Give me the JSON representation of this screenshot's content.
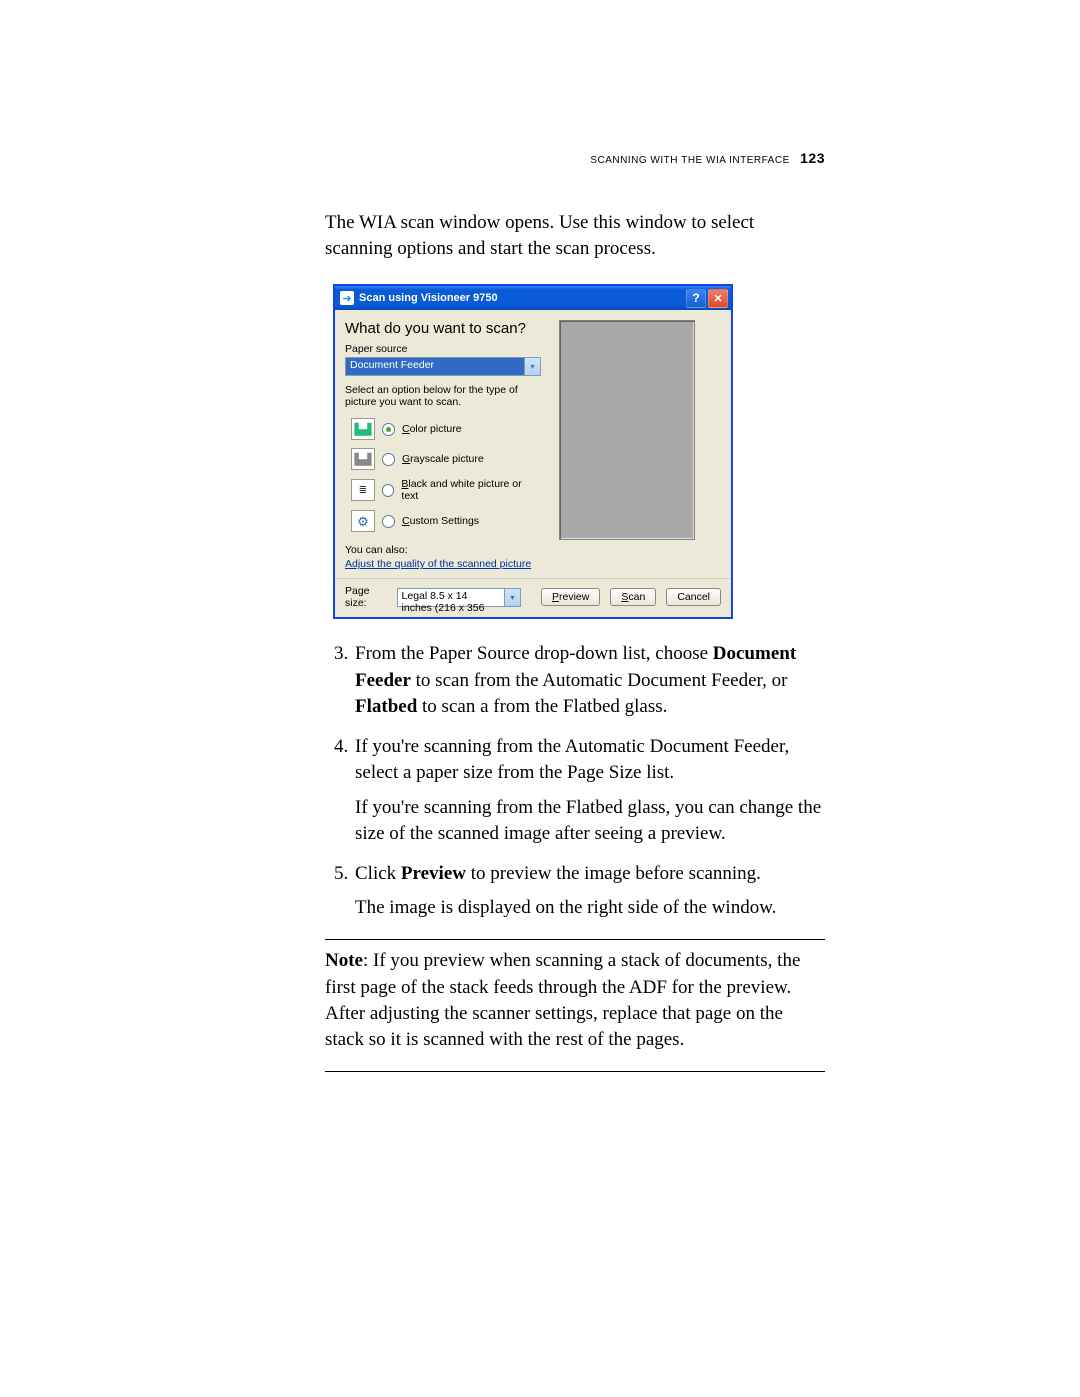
{
  "header": {
    "section": "Scanning with the WIA Interface",
    "page": "123"
  },
  "intro": "The WIA scan window opens. Use this window to select scanning options and start the scan process.",
  "window": {
    "title": "Scan using Visioneer 9750",
    "help": "?",
    "close": "✕",
    "heading": "What do you want to scan?",
    "paper_source_label": "Paper source",
    "paper_source_value": "Document Feeder",
    "select_instruction": "Select an option below for the type of picture you want to scan.",
    "options": {
      "color_pre": "C",
      "color_rest": "olor picture",
      "gray_pre": "G",
      "gray_rest": "rayscale picture",
      "bw_pre": "B",
      "bw_rest": "lack and white picture or text",
      "custom_pre": "C",
      "custom_rest": "ustom Settings"
    },
    "also_label": "You can also:",
    "adjust_link": "Adjust the quality of the scanned picture",
    "page_size_label": "Page size:",
    "page_size_value": "Legal 8.5 x 14 inches (216 x 356",
    "btn_preview_pre": "P",
    "btn_preview_rest": "review",
    "btn_scan_pre": "S",
    "btn_scan_rest": "can",
    "btn_cancel": "Cancel"
  },
  "steps": {
    "s3a": "From the Paper Source drop-down list, choose ",
    "s3b": "Document Feeder",
    "s3c": " to scan from the Automatic Document Feeder, or ",
    "s3d": "Flatbed",
    "s3e": " to scan a from the Flatbed glass.",
    "s4a": "If you're scanning from the Automatic Document Feeder, select a paper size from the Page Size list.",
    "s4b": "If you're scanning from the Flatbed glass, you can change the size of the scanned image after seeing a preview.",
    "s5a": "Click ",
    "s5b": "Preview",
    "s5c": " to preview the image before scanning.",
    "s5d": "The image is displayed on the right side of the window."
  },
  "note": {
    "label": "Note",
    "body": ":  If you preview when scanning a stack of documents, the first page of the stack feeds through the ADF for the preview. After adjusting the scanner settings, replace that page on the stack so it is scanned with the rest of the pages."
  }
}
